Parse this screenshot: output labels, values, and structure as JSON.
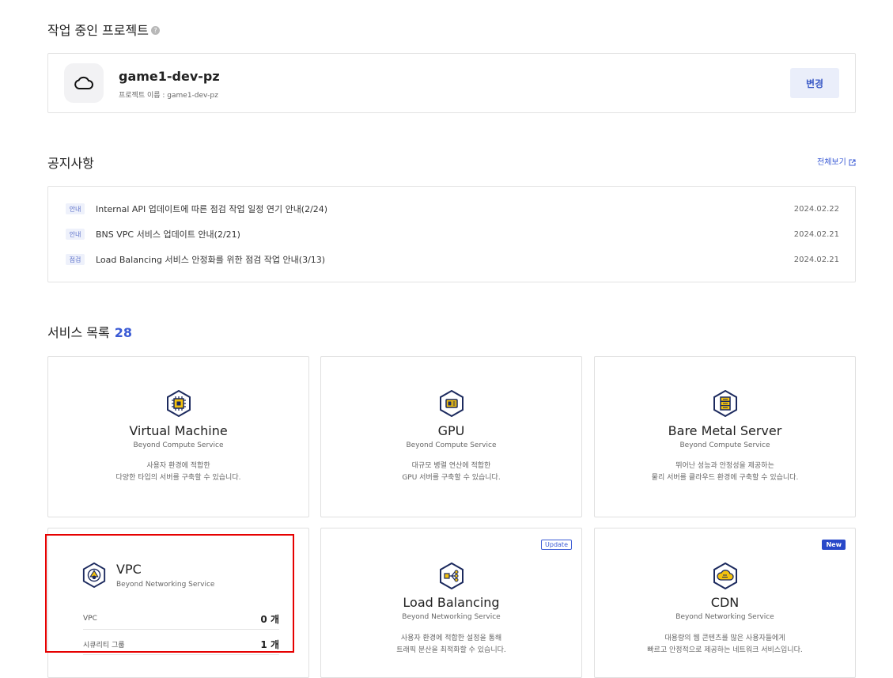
{
  "project_section": {
    "title": "작업 중인 프로젝트",
    "help": "?",
    "name": "game1-dev-pz",
    "subtitle": "프로젝트 이름 : game1-dev-pz",
    "change_label": "변경"
  },
  "notices": {
    "title": "공지사항",
    "view_all": "전체보기",
    "items": [
      {
        "badge": "안내",
        "text": "Internal API 업데이트에 따른 점검 작업 일정 연기 안내(2/24)",
        "date": "2024.02.22"
      },
      {
        "badge": "안내",
        "text": "BNS VPC 서비스 업데이트 안내(2/21)",
        "date": "2024.02.21"
      },
      {
        "badge": "점검",
        "text": "Load Balancing 서비스 안정화를 위한 점검 작업 안내(3/13)",
        "date": "2024.02.21"
      }
    ]
  },
  "services": {
    "title": "서비스 목록",
    "count": "28",
    "cards": [
      {
        "name": "Virtual Machine",
        "category": "Beyond Compute Service",
        "desc1": "사용자 환경에 적합한",
        "desc2": "다양한 타입의 서버를 구축할 수 있습니다.",
        "icon": "chip-icon"
      },
      {
        "name": "GPU",
        "category": "Beyond Compute Service",
        "desc1": "대규모 병렬 연산에 적합한",
        "desc2": "GPU 서버를 구축할 수 있습니다.",
        "icon": "gpu-icon"
      },
      {
        "name": "Bare Metal Server",
        "category": "Beyond Compute Service",
        "desc1": "뛰어난 성능과 안정성을 제공하는",
        "desc2": "물리 서버를 클라우드 환경에 구축할 수 있습니다.",
        "icon": "server-icon"
      },
      {
        "name": "VPC",
        "category": "Beyond Networking Service",
        "icon": "vpc-icon",
        "rows": [
          {
            "label": "VPC",
            "value": "0 개"
          },
          {
            "label": "시큐리티 그룹",
            "value": "1 개"
          }
        ]
      },
      {
        "name": "Load Balancing",
        "category": "Beyond Networking Service",
        "tag": "Update",
        "desc1": "사용자 환경에 적합한 설정을 통해",
        "desc2": "트래픽 분산을 최적화할 수 있습니다.",
        "icon": "load-balancer-icon"
      },
      {
        "name": "CDN",
        "category": "Beyond Networking Service",
        "tag": "New",
        "desc1": "대용량의 웹 콘텐츠를 많은 사용자들에게",
        "desc2": "빠르고 안정적으로 제공하는 네트워크 서비스입니다.",
        "icon": "cdn-icon"
      }
    ]
  },
  "colors": {
    "accent": "#3b5bd5",
    "icon_navy": "#1c2a5e",
    "icon_yellow": "#f4c20d",
    "highlight": "#e60000"
  }
}
